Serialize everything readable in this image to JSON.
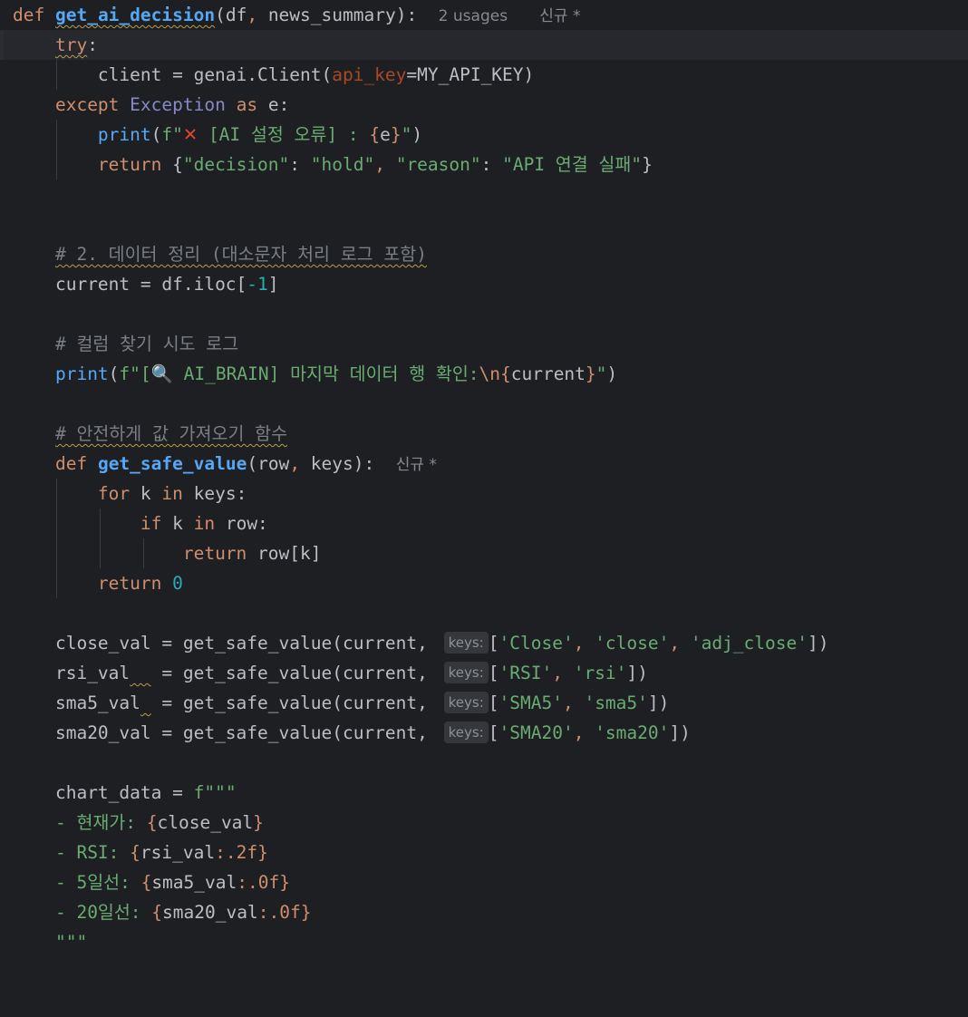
{
  "editor": {
    "colors": {
      "background": "#1e1f22",
      "keyword": "#cf8e6d",
      "function": "#56a8f5",
      "string": "#6aab73",
      "number": "#2aacb8",
      "comment": "#7a7e85",
      "parameter": "#aa4926"
    },
    "lines": {
      "l1": {
        "kw": "def",
        "name": "get_ai_decision",
        "open": "(",
        "p1": "df",
        "sep": ", ",
        "p2": "news_summary",
        "close": "):",
        "usages": "2 usages",
        "status": "신규 *"
      },
      "l2": {
        "kw": "try",
        "colon": ":"
      },
      "l3": {
        "a": "client = genai.Client(",
        "named": "api_key",
        "b": "=MY_API_KEY)"
      },
      "l4": {
        "kw1": "except",
        "cls": "Exception",
        "kw2": "as",
        "rest": "e:"
      },
      "l5": {
        "fn": "print",
        "open": "(",
        "f": "f\"",
        "emoji": "✕",
        "s1": " [AI 설정 오류] : ",
        "lb": "{",
        "var": "e",
        "rb": "}",
        "s2": "\"",
        "close": ")"
      },
      "l6": {
        "kw": "return",
        "b1": "{",
        "k1": "\"decision\"",
        "c1": ": ",
        "v1": "\"hold\"",
        "cm": ", ",
        "k2": "\"reason\"",
        "c2": ": ",
        "v2": "\"API 연결 실패\"",
        "b2": "}"
      },
      "l7": {
        "comment": "# 2. 데이터 정리 (대소문자 처리 로그 포함)"
      },
      "l8": {
        "a": "current = df.iloc[",
        "neg": "-",
        "num": "1",
        "b": "]"
      },
      "l9": {
        "comment": "# 컬럼 찾기 시도 로그"
      },
      "l10": {
        "fn": "print",
        "open": "(",
        "f": "f\"[",
        "emoji": "🔍",
        "s1": " AI_BRAIN] 마지막 데이터 행 확인:",
        "esc": "\\n",
        "lb": "{",
        "var": "current",
        "rb": "}",
        "s2": "\"",
        "close": ")"
      },
      "l11": {
        "comment": "# 안전하게 값 가져오기 함수"
      },
      "l12": {
        "kw": "def",
        "name": "get_safe_value",
        "open": "(",
        "p1": "row",
        "sep": ", ",
        "p2": "keys",
        "close": "):",
        "status": "신규 *"
      },
      "l13": {
        "kw1": "for",
        "v": " k ",
        "kw2": "in",
        "rest": " keys:"
      },
      "l14": {
        "kw1": "if",
        "v": " k ",
        "kw2": "in",
        "rest": " row:"
      },
      "l15": {
        "kw": "return",
        "rest": " row[k]"
      },
      "l16": {
        "kw": "return",
        "num": "0"
      },
      "l17": {
        "a": "close_val = get_safe_value(current, ",
        "hint": "keys:",
        "open": "[",
        "s1": "'Close'",
        "c1": ", ",
        "s2": "'close'",
        "c2": ", ",
        "s3": "'adj_close'",
        "close": "])"
      },
      "l18": {
        "a1": "rsi_val",
        "ws": "  ",
        "a2": " = get_safe_value(current, ",
        "hint": "keys:",
        "open": "[",
        "s1": "'RSI'",
        "c1": ", ",
        "s2": "'rsi'",
        "close": "])"
      },
      "l19": {
        "a1": "sma5_val",
        "ws": " ",
        "a2": " = get_safe_value(current, ",
        "hint": "keys:",
        "open": "[",
        "s1": "'SMA5'",
        "c1": ", ",
        "s2": "'sma5'",
        "close": "])"
      },
      "l20": {
        "a": "sma20_val = get_safe_value(current, ",
        "hint": "keys:",
        "open": "[",
        "s1": "'SMA20'",
        "c1": ", ",
        "s2": "'sma20'",
        "close": "])"
      },
      "l21": {
        "a": "chart_data = ",
        "f": "f\"\"\""
      },
      "l22": {
        "s": "- 현재가: ",
        "lb": "{",
        "var": "close_val",
        "rb": "}"
      },
      "l23": {
        "s": "- RSI: ",
        "lb": "{",
        "var": "rsi_val",
        "fmt": ":.2f",
        "rb": "}"
      },
      "l24": {
        "s": "- 5일선: ",
        "lb": "{",
        "var": "sma5_val",
        "fmt": ":.0f",
        "rb": "}"
      },
      "l25": {
        "s": "- 20일선: ",
        "lb": "{",
        "var": "sma20_val",
        "fmt": ":.0f",
        "rb": "}"
      },
      "l26": {
        "s": "\"\"\""
      }
    }
  }
}
